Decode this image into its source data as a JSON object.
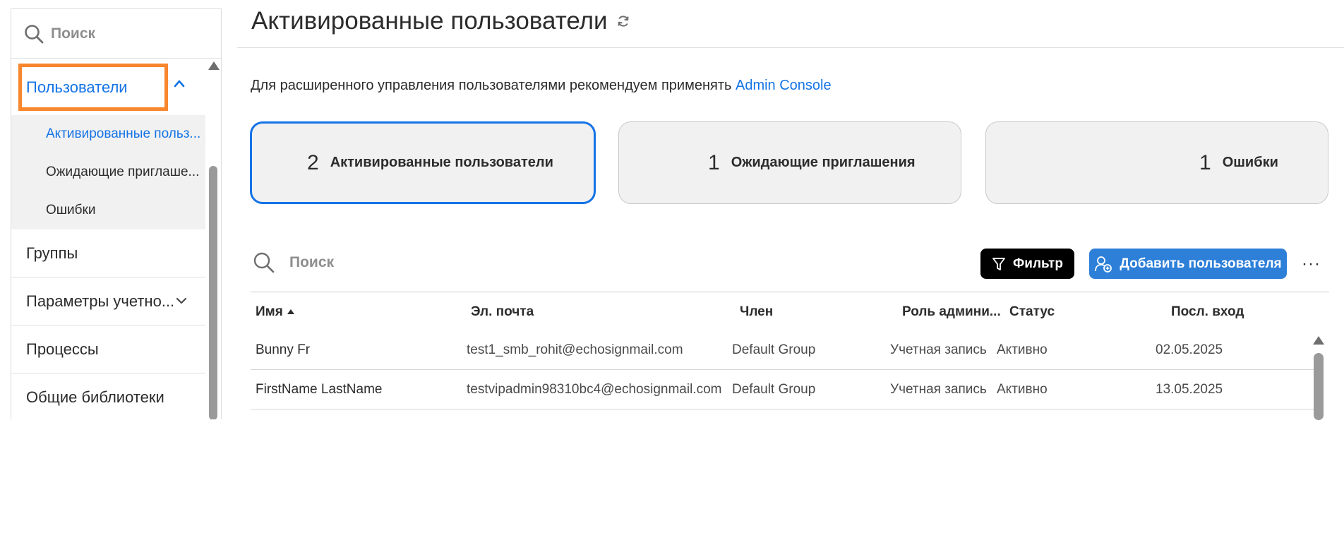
{
  "sidebar": {
    "search_placeholder": "Поиск",
    "users_label": "Пользователи",
    "sub_items": [
      {
        "label": "Активированные польз..."
      },
      {
        "label": "Ожидающие приглаше..."
      },
      {
        "label": "Ошибки"
      }
    ],
    "groups_label": "Группы",
    "account_settings_label": "Параметры учетно...",
    "processes_label": "Процессы",
    "libraries_label": "Общие библиотеки"
  },
  "header": {
    "title": "Активированные пользователи"
  },
  "info": {
    "text": "Для расширенного управления пользователями рекомендуем применять ",
    "link": "Admin Console"
  },
  "cards": [
    {
      "count": "2",
      "label": "Активированные пользователи"
    },
    {
      "count": "1",
      "label": "Ожидающие приглашения"
    },
    {
      "count": "1",
      "label": "Ошибки"
    }
  ],
  "toolbar": {
    "search_placeholder": "Поиск",
    "filter_label": "Фильтр",
    "add_user_label": "Добавить пользователя",
    "more_label": "···"
  },
  "table": {
    "columns": [
      "Имя",
      "Эл. почта",
      "Член",
      "Роль админи...",
      "Статус",
      "Посл. вход"
    ],
    "rows": [
      {
        "name": "Bunny Fr",
        "email": "test1_smb_rohit@echosignmail.com",
        "group": "Default Group",
        "role": "Учетная запись",
        "status": "Активно",
        "last_login": "02.05.2025"
      },
      {
        "name": "FirstName LastName",
        "email": "testvipadmin98310bc4@echosignmail.com",
        "group": "Default Group",
        "role": "Учетная запись",
        "status": "Активно",
        "last_login": "13.05.2025"
      }
    ]
  },
  "colors": {
    "accent": "#1473e6",
    "highlight": "#f7862c",
    "filter_button": "#000000",
    "add_button": "#2d7fd8"
  },
  "icons": [
    "search-icon",
    "chevron-up-icon",
    "chevron-down-icon",
    "refresh-icon",
    "filter-icon",
    "add-user-icon",
    "more-icon"
  ]
}
